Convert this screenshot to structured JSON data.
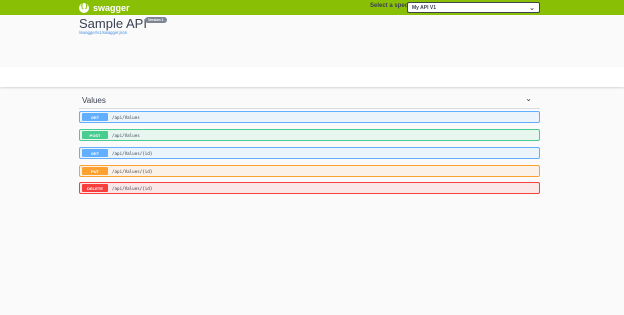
{
  "topbar": {
    "logo_text": "swagger",
    "logo_icon": "swagger-logo-icon",
    "spec_label": "Select a spec",
    "spec_selected": "My API V1"
  },
  "info": {
    "title": "Sample API",
    "version": "Version 1",
    "url": "/swagger/v1/swagger.json"
  },
  "section": {
    "title": "Values"
  },
  "operations": [
    {
      "method": "GET",
      "path": "/api/Values"
    },
    {
      "method": "POST",
      "path": "/api/Values"
    },
    {
      "method": "GET",
      "path": "/api/Values/{id}"
    },
    {
      "method": "PUT",
      "path": "/api/Values/{id}"
    },
    {
      "method": "DELETE",
      "path": "/api/Values/{id}"
    }
  ],
  "colors": {
    "topbar": "#89bf04",
    "get": "#61affe",
    "post": "#49cc90",
    "put": "#fca130",
    "delete": "#f93e3e"
  }
}
